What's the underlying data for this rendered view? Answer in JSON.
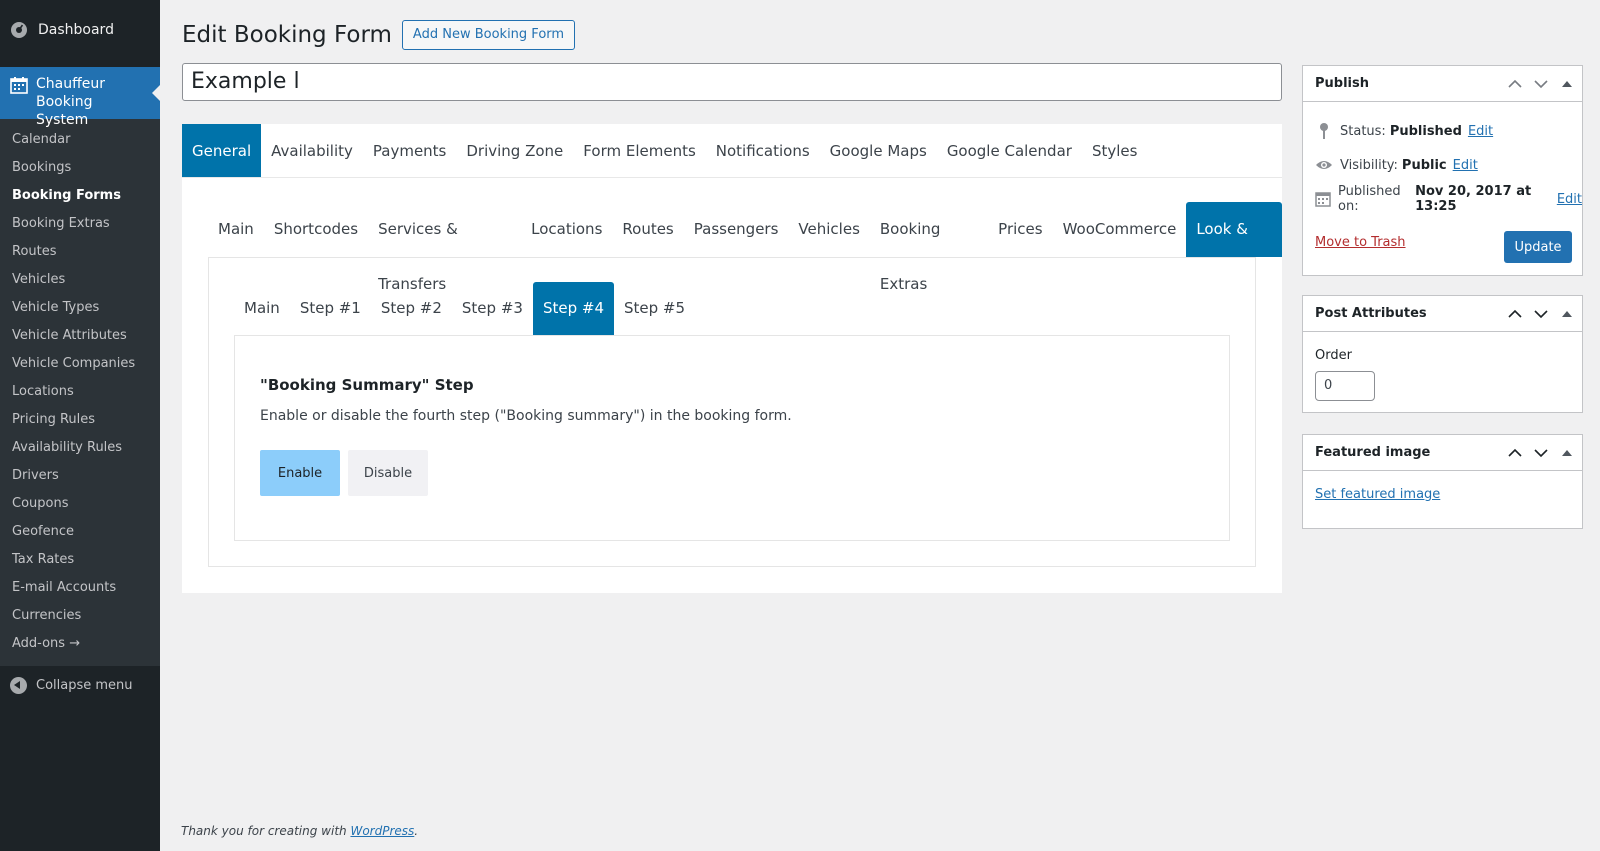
{
  "sidebar": {
    "dashboard": "Dashboard",
    "active_menu": "Chauffeur Booking System",
    "items": [
      {
        "label": "Calendar"
      },
      {
        "label": "Bookings"
      },
      {
        "label": "Booking Forms",
        "current": true
      },
      {
        "label": "Booking Extras"
      },
      {
        "label": "Routes"
      },
      {
        "label": "Vehicles"
      },
      {
        "label": "Vehicle Types"
      },
      {
        "label": "Vehicle Attributes"
      },
      {
        "label": "Vehicle Companies"
      },
      {
        "label": "Locations"
      },
      {
        "label": "Pricing Rules"
      },
      {
        "label": "Availability Rules"
      },
      {
        "label": "Drivers"
      },
      {
        "label": "Coupons"
      },
      {
        "label": "Geofence"
      },
      {
        "label": "Tax Rates"
      },
      {
        "label": "E-mail Accounts"
      },
      {
        "label": "Currencies"
      },
      {
        "label": "Add-ons →"
      }
    ],
    "collapse": "Collapse menu"
  },
  "header": {
    "title": "Edit Booking Form",
    "add_new": "Add New Booking Form"
  },
  "post_title": "Example l",
  "tabs_main": [
    "General",
    "Availability",
    "Payments",
    "Driving Zone",
    "Form Elements",
    "Notifications",
    "Google Maps",
    "Google Calendar",
    "Styles"
  ],
  "tabs_sub": [
    "Main",
    "Shortcodes",
    "Services & Transfers",
    "Locations",
    "Routes",
    "Passengers",
    "Vehicles",
    "Booking Extras",
    "Prices",
    "WooCommerce",
    "Look & Feel"
  ],
  "tabs_step": [
    "Main",
    "Step #1",
    "Step #2",
    "Step #3",
    "Step #4",
    "Step #5"
  ],
  "step_section": {
    "title": "\"Booking Summary\" Step",
    "description": "Enable or disable the fourth step (\"Booking summary\") in the booking form.",
    "enable": "Enable",
    "disable": "Disable"
  },
  "publish_box": {
    "title": "Publish",
    "status_label": "Status:",
    "status_value": "Published",
    "visibility_label": "Visibility:",
    "visibility_value": "Public",
    "published_label": "Published on:",
    "published_value": "Nov 20, 2017 at 13:25",
    "edit": "Edit",
    "trash": "Move to Trash",
    "update": "Update"
  },
  "attributes_box": {
    "title": "Post Attributes",
    "order_label": "Order",
    "order_value": "0"
  },
  "featured_box": {
    "title": "Featured image",
    "link": "Set featured image"
  },
  "footer": {
    "text": "Thank you for creating with",
    "link": "WordPress",
    "suffix": "."
  },
  "colors": {
    "accent": "#2271b1",
    "tab_active": "#0073aa",
    "sidebar_bg": "#1d2327",
    "enable_bg": "#8ccdfa"
  }
}
